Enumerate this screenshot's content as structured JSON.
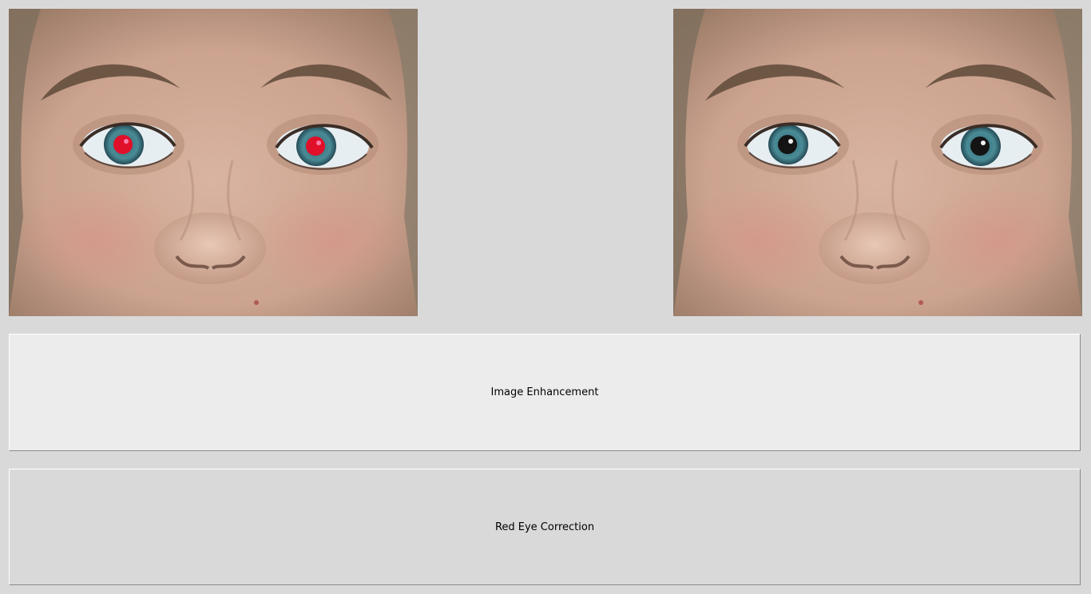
{
  "images": {
    "original": {
      "pupil_color": "#e0102a",
      "catchlight_color": "#ff7aa8"
    },
    "corrected": {
      "pupil_color": "#141414",
      "catchlight_color": "#f2f2f2"
    }
  },
  "buttons": {
    "enhance_label": "Image Enhancement",
    "redeye_label": "Red Eye Correction"
  },
  "colors": {
    "window_bg": "#d9d9d9",
    "skin": "#cfa994",
    "iris": "#3f7f8c",
    "sclera": "#e6eef2",
    "brow": "#6e5645",
    "hair": "#8c7f6e"
  }
}
